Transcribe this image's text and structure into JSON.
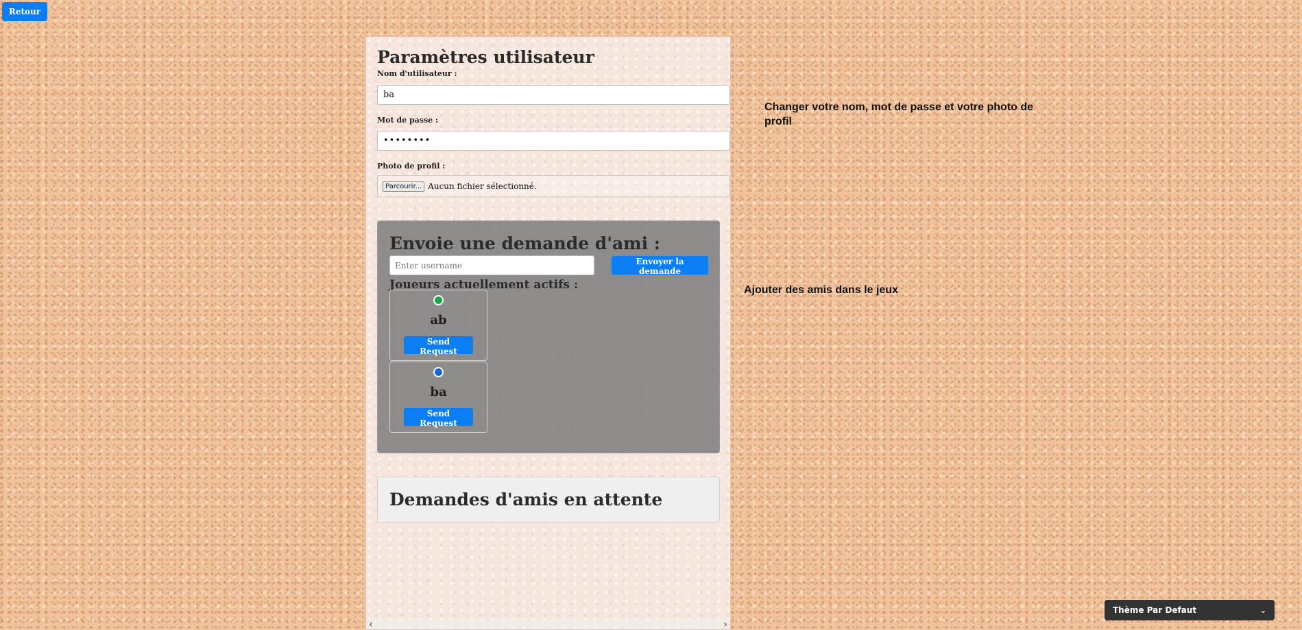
{
  "nav": {
    "back_label": "Retour"
  },
  "settings": {
    "title": "Paramètres utilisateur",
    "username_label": "Nom d'utilisateur :",
    "username_value": "ba",
    "password_label": "Mot de passe :",
    "password_value": "••••••••",
    "photo_label": "Photo de profil :",
    "browse_label": "Parcourir...",
    "file_status": "Aucun fichier sélectionné."
  },
  "friend_request": {
    "title": "Envoie une demande d'ami :",
    "input_placeholder": "Enter username",
    "send_label": "Envoyer la demande",
    "active_title": "Joueurs actuellement actifs :",
    "players": [
      {
        "name": "ab",
        "avatar_color": "#1aa64a",
        "button_label": "Send Request"
      },
      {
        "name": "ba",
        "avatar_color": "#1565d8",
        "button_label": "Send Request"
      }
    ]
  },
  "pending": {
    "title": "Demandes d'amis en attente"
  },
  "scrollbar": {
    "left_icon": "‹",
    "right_icon": "›"
  },
  "notes": {
    "settings_hint": "Changer votre nom, mot de passe et votre photo de profil",
    "friends_hint": "Ajouter des amis dans le jeux"
  },
  "theme": {
    "selected": "Thème Par Defaut",
    "chevron_icon": "⌄"
  },
  "colors": {
    "accent": "#0b7ef6",
    "friend_box": "#808080",
    "theme_select": "#333333"
  }
}
